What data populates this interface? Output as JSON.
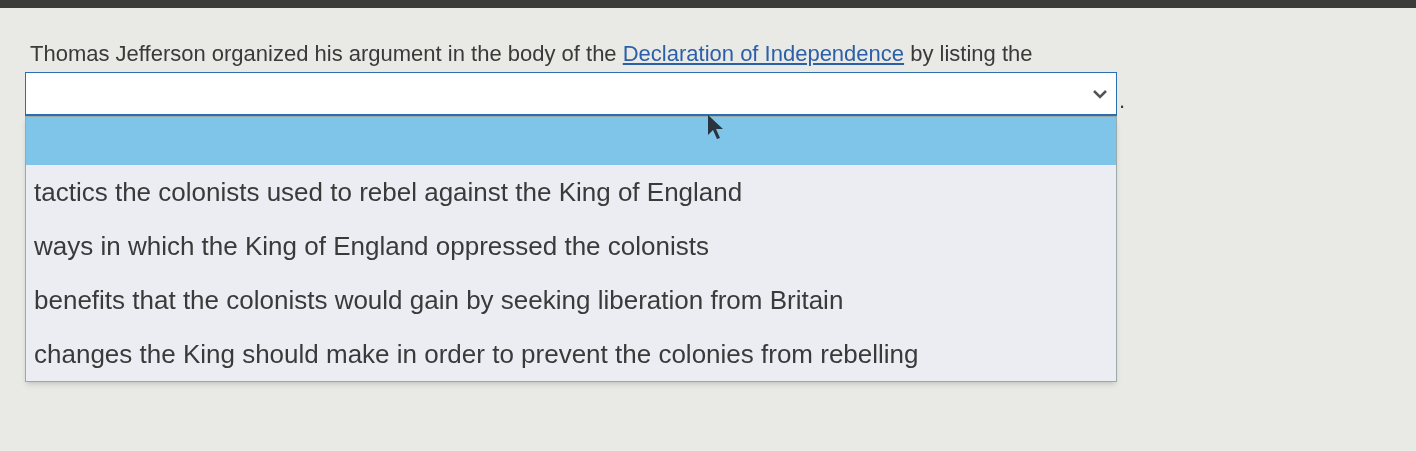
{
  "question": {
    "text_before": "Thomas Jefferson organized his argument in the body of the",
    "link": "Declaration of Independence",
    "text_after": "by listing the",
    "trailing": "."
  },
  "dropdown": {
    "expanded": true,
    "blank_option": {
      "selected": true
    },
    "options": [
      {
        "label": "tactics the colonists used to rebel against the King of England",
        "selected": false
      },
      {
        "label": "ways in which the King of England oppressed the colonists",
        "selected": false
      },
      {
        "label": "benefits that the colonists would gain by seeking liberation from Britain",
        "selected": false
      },
      {
        "label": "changes the King should make in order to prevent the colonies from rebelling",
        "selected": false
      }
    ]
  }
}
